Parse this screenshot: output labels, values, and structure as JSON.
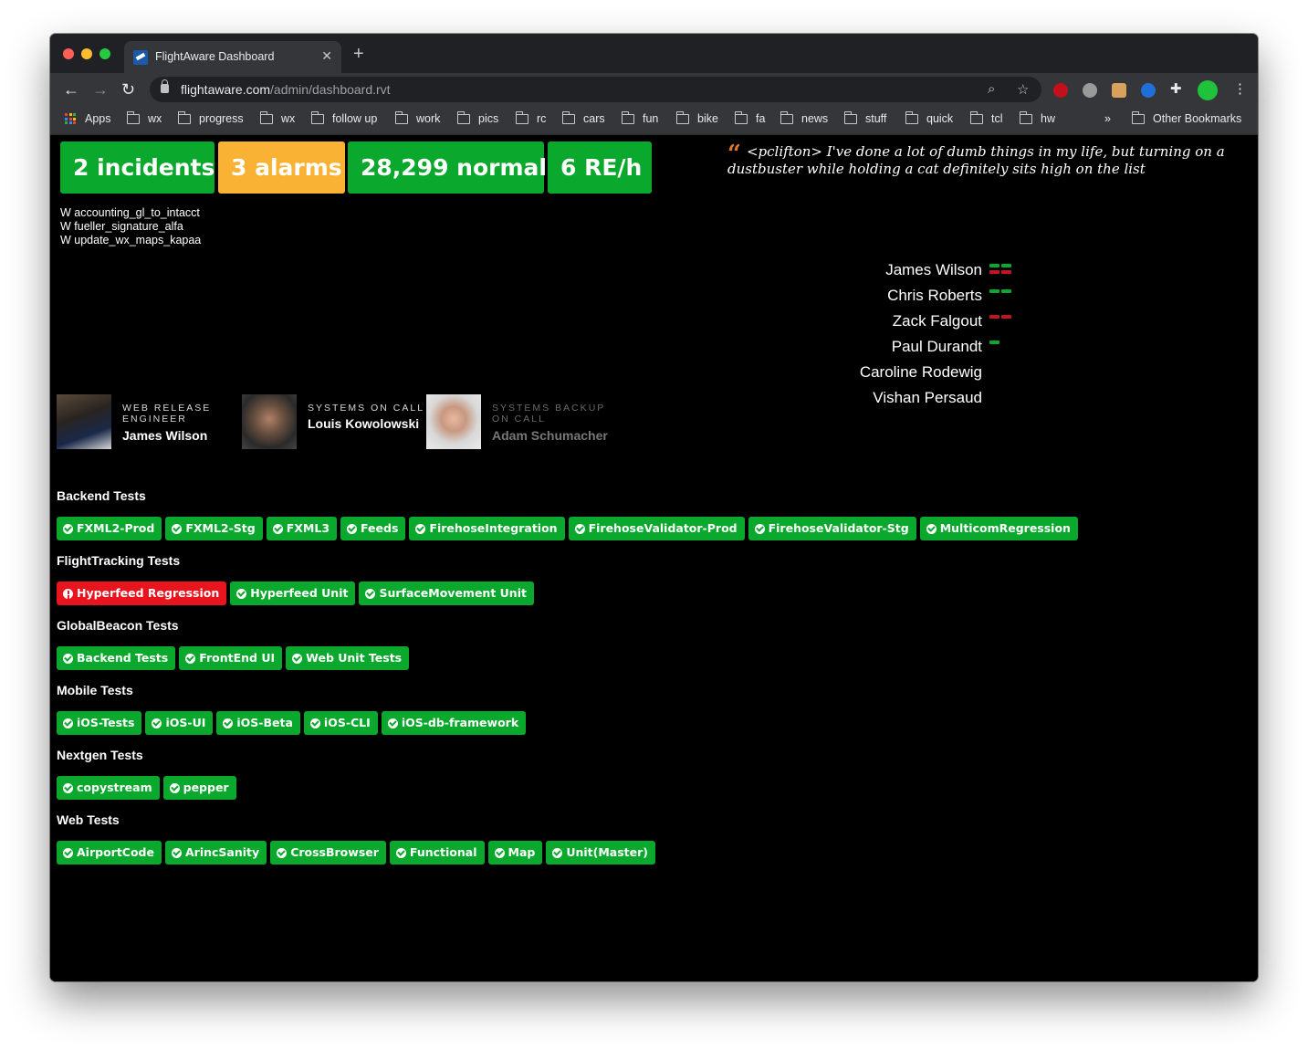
{
  "browser": {
    "tab_title": "FlightAware Dashboard",
    "url_host": "flightaware.com",
    "url_path": "/admin/dashboard.rvt",
    "bookmarks": [
      "Apps",
      "wx",
      "progress",
      "wx",
      "follow up",
      "work",
      "pics",
      "rc",
      "cars",
      "fun",
      "bike",
      "fa",
      "news",
      "stuff",
      "quick",
      "tcl",
      "hw"
    ],
    "overflow": "»",
    "other_bookmarks": "Other Bookmarks"
  },
  "stats": {
    "incidents": "2 incidents",
    "alarms": "3 alarms",
    "normal": "28,299 normal",
    "re_rate": "6 RE/h"
  },
  "incident_lines": [
    "W accounting_gl_to_intacct",
    "W fueller_signature_alfa",
    "W update_wx_maps_kapaa"
  ],
  "quote": {
    "mark": "“",
    "text": "<pclifton> I've done a lot of dumb things in my life, but turning on a dustbuster while holding a cat definitely sits high on the list"
  },
  "people": [
    {
      "name": "James Wilson",
      "bars": [
        [
          "#0aa82c",
          "#0aa82c"
        ],
        [
          "#c0161e",
          "#c0161e"
        ]
      ]
    },
    {
      "name": "Chris Roberts",
      "bars": [
        [
          "#0aa82c",
          "#0aa82c"
        ]
      ]
    },
    {
      "name": "Zack Falgout",
      "bars": [
        [
          "#c0161e",
          "#c0161e"
        ]
      ]
    },
    {
      "name": "Paul Durandt",
      "bars": [
        [
          "#0aa82c"
        ]
      ]
    },
    {
      "name": "Caroline Rodewig",
      "bars": []
    },
    {
      "name": "Vishan Persaud",
      "bars": []
    }
  ],
  "oncall": [
    {
      "role_1": "WEB RELEASE",
      "role_2": "ENGINEER",
      "name": "James Wilson"
    },
    {
      "role_1": "SYSTEMS ON CALL",
      "role_2": "",
      "name": "Louis Kowolowski"
    },
    {
      "role_1": "SYSTEMS BACKUP",
      "role_2": "ON CALL",
      "name": "Adam Schumacher"
    }
  ],
  "test_groups": [
    {
      "title": "Backend Tests",
      "tests": [
        {
          "label": "FXML2-Prod",
          "status": "pass"
        },
        {
          "label": "FXML2-Stg",
          "status": "pass"
        },
        {
          "label": "FXML3",
          "status": "pass"
        },
        {
          "label": "Feeds",
          "status": "pass"
        },
        {
          "label": "FirehoseIntegration",
          "status": "pass"
        },
        {
          "label": "FirehoseValidator-Prod",
          "status": "pass"
        },
        {
          "label": "FirehoseValidator-Stg",
          "status": "pass"
        },
        {
          "label": "MulticomRegression",
          "status": "pass"
        }
      ]
    },
    {
      "title": "FlightTracking Tests",
      "tests": [
        {
          "label": "Hyperfeed Regression",
          "status": "fail"
        },
        {
          "label": "Hyperfeed Unit",
          "status": "pass"
        },
        {
          "label": "SurfaceMovement Unit",
          "status": "pass"
        }
      ]
    },
    {
      "title": "GlobalBeacon Tests",
      "tests": [
        {
          "label": "Backend Tests",
          "status": "pass"
        },
        {
          "label": "FrontEnd UI",
          "status": "pass"
        },
        {
          "label": "Web Unit Tests",
          "status": "pass"
        }
      ]
    },
    {
      "title": "Mobile Tests",
      "tests": [
        {
          "label": "iOS-Tests",
          "status": "pass"
        },
        {
          "label": "iOS-UI",
          "status": "pass"
        },
        {
          "label": "iOS-Beta",
          "status": "pass"
        },
        {
          "label": "iOS-CLI",
          "status": "pass"
        },
        {
          "label": "iOS-db-framework",
          "status": "pass"
        }
      ]
    },
    {
      "title": "Nextgen Tests",
      "tests": [
        {
          "label": "copystream",
          "status": "pass"
        },
        {
          "label": "pepper",
          "status": "pass"
        }
      ]
    },
    {
      "title": "Web Tests",
      "tests": [
        {
          "label": "AirportCode",
          "status": "pass"
        },
        {
          "label": "ArincSanity",
          "status": "pass"
        },
        {
          "label": "CrossBrowser",
          "status": "pass"
        },
        {
          "label": "Functional",
          "status": "pass"
        },
        {
          "label": "Map",
          "status": "pass"
        },
        {
          "label": "Unit(Master)",
          "status": "pass"
        }
      ]
    }
  ],
  "colors": {
    "pass": "#0aa82c",
    "fail": "#e8141e",
    "alarm": "#f9b233",
    "quote_mark": "#e0762a"
  }
}
